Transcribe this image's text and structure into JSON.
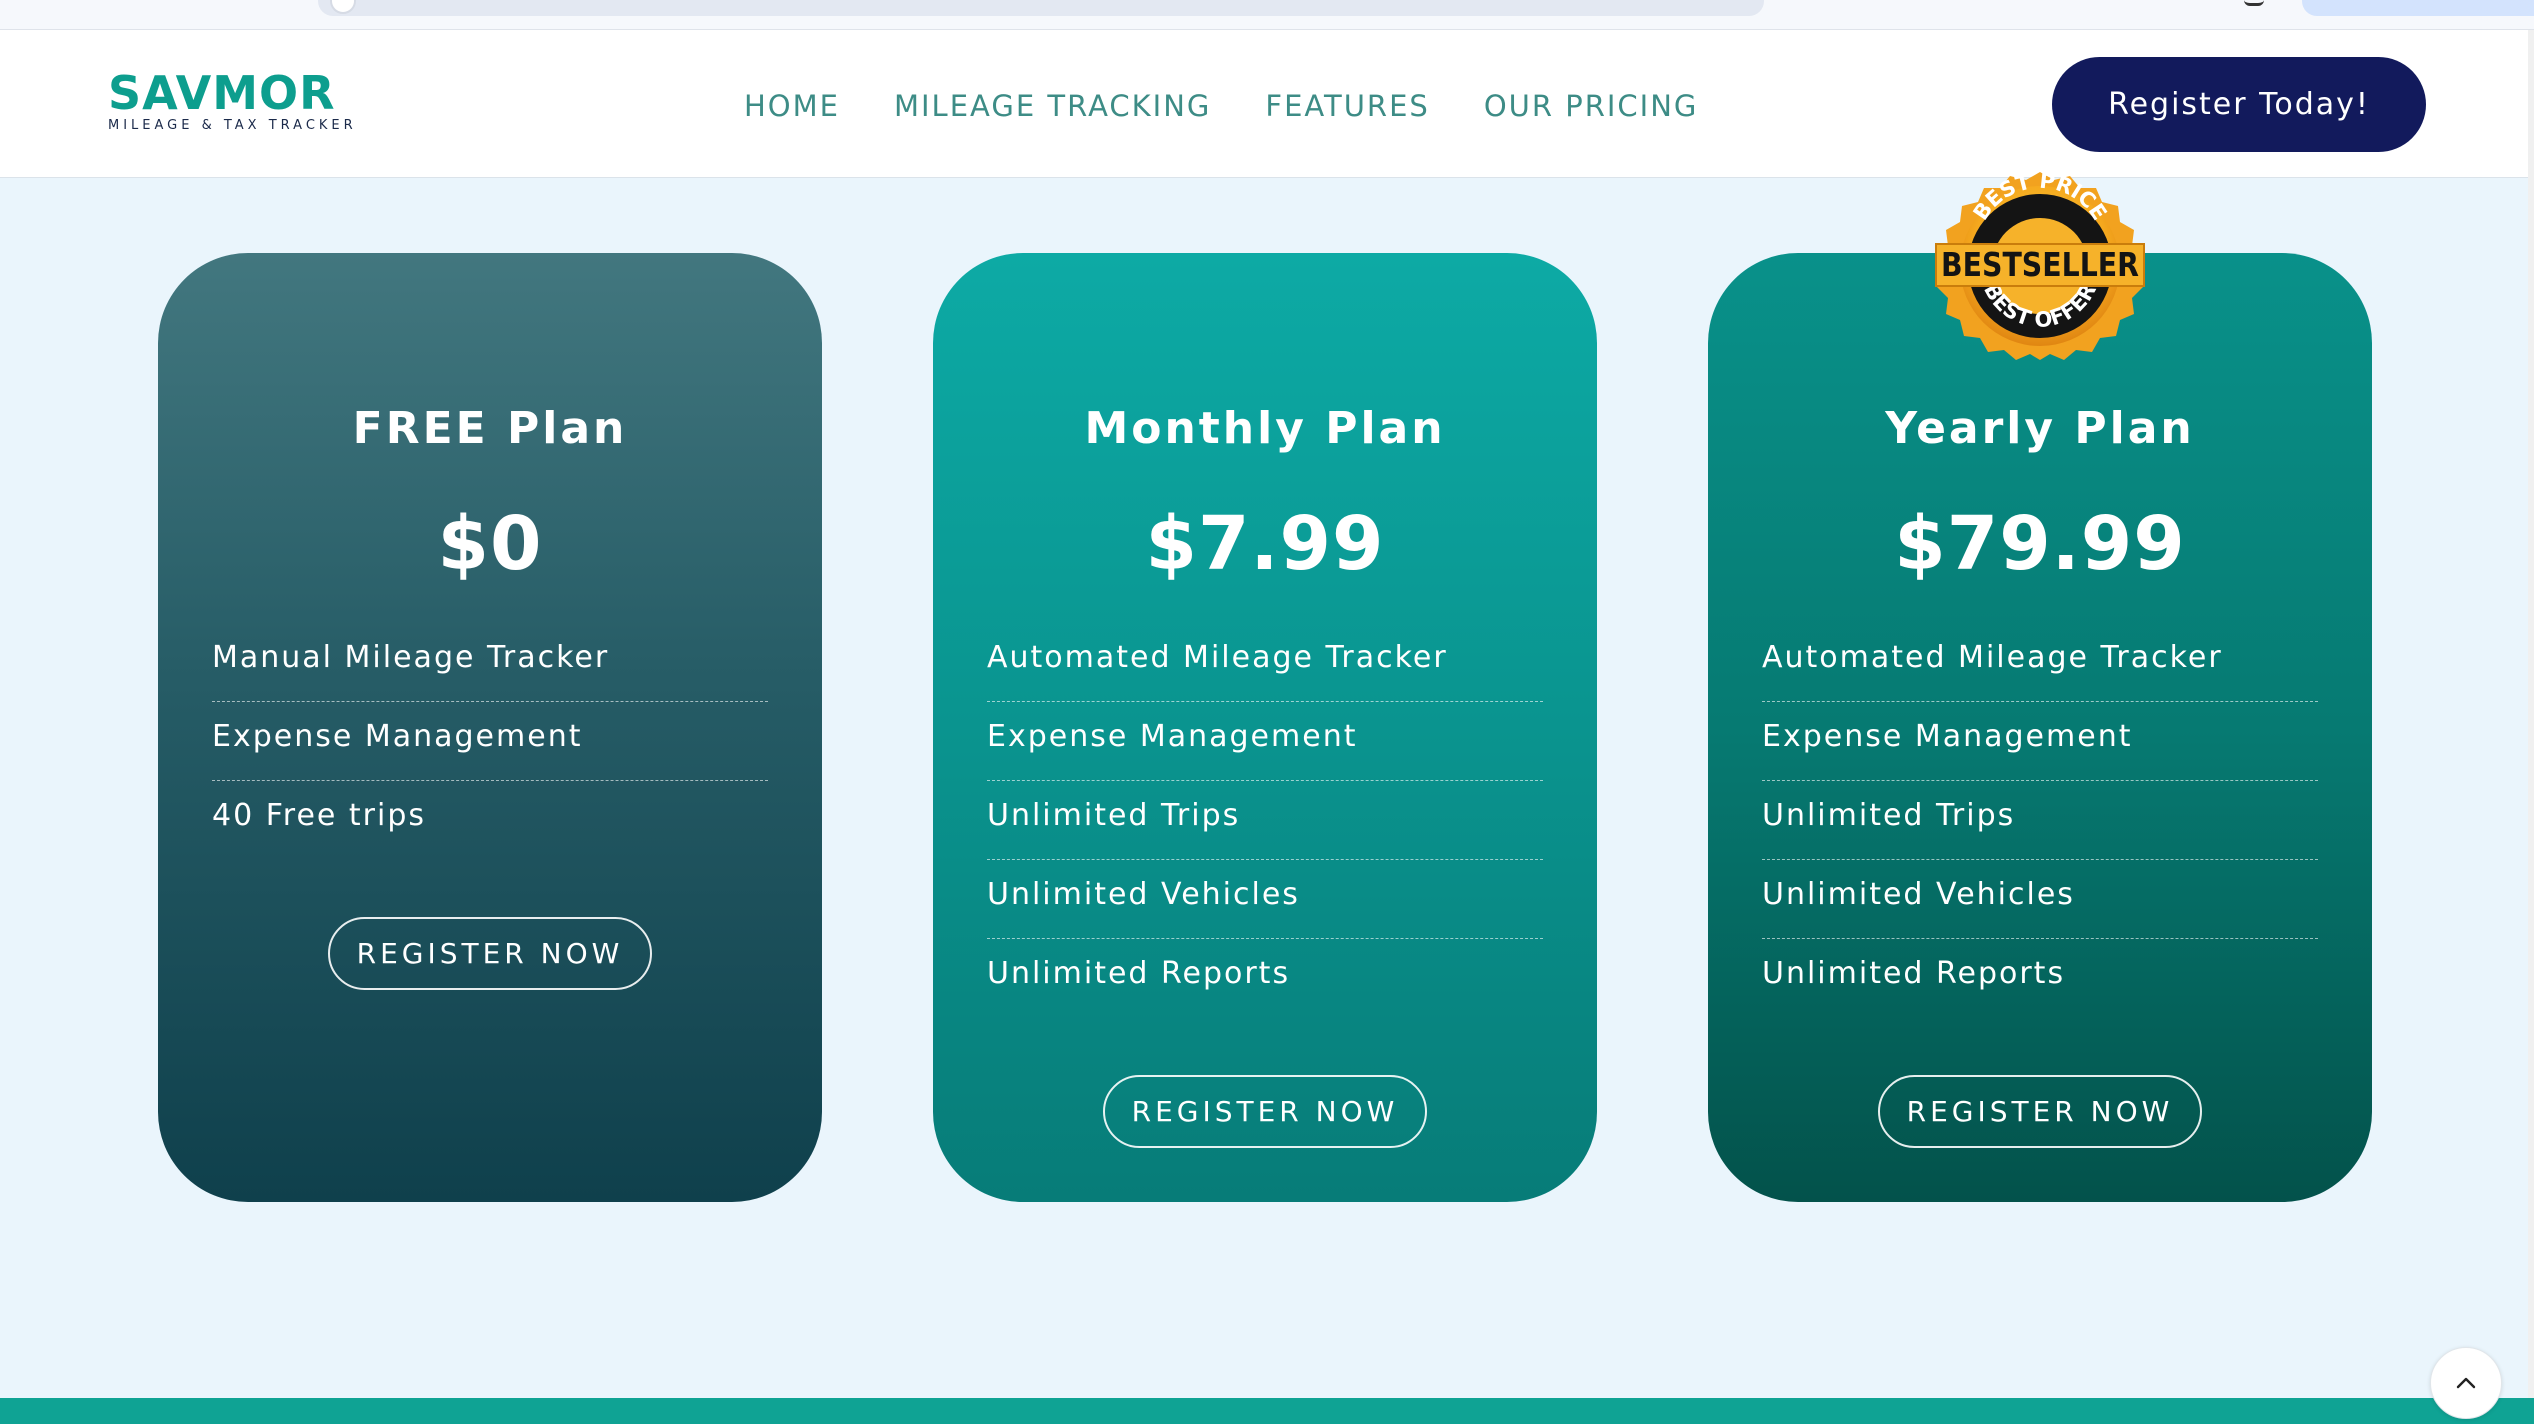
{
  "header": {
    "logo_main": "SAVMOR",
    "logo_sub": "MILEAGE & TAX TRACKER",
    "nav": [
      {
        "label": "HOME"
      },
      {
        "label": "MILEAGE TRACKING"
      },
      {
        "label": "FEATURES"
      },
      {
        "label": "OUR PRICING"
      }
    ],
    "cta_label": "Register Today!"
  },
  "colors": {
    "brand_teal": "#0d9e8e",
    "cta_navy": "#121a5c",
    "page_bg": "#eaf5fc"
  },
  "badge": {
    "top_text": "BEST PRICE",
    "main_text": "BESTSELLER",
    "bottom_text": "BEST OFFER"
  },
  "plans": [
    {
      "title": "FREE Plan",
      "price": "$0",
      "features": [
        "Manual Mileage Tracker",
        "Expense Management",
        "40 Free trips"
      ],
      "button": "REGISTER NOW"
    },
    {
      "title": "Monthly Plan",
      "price": "$7.99",
      "features": [
        "Automated Mileage Tracker",
        "Expense Management",
        "Unlimited Trips",
        "Unlimited Vehicles",
        "Unlimited Reports"
      ],
      "button": "REGISTER NOW"
    },
    {
      "title": "Yearly Plan",
      "price": "$79.99",
      "features": [
        "Automated Mileage Tracker",
        "Expense Management",
        "Unlimited Trips",
        "Unlimited Vehicles",
        "Unlimited Reports"
      ],
      "button": "REGISTER NOW"
    }
  ],
  "icons": {
    "scroll_top": "chevron-up-icon"
  }
}
